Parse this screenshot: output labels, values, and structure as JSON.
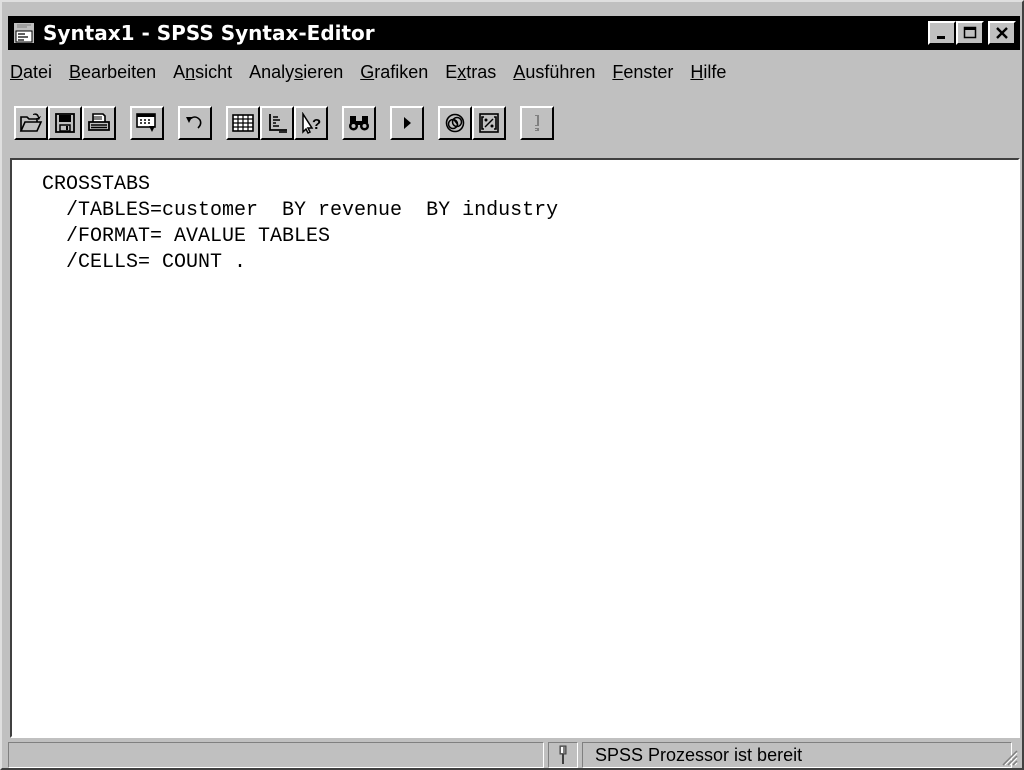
{
  "window": {
    "title": "Syntax1 - SPSS Syntax-Editor",
    "icon": "spss-syntax-icon",
    "controls": [
      "minimize-icon",
      "maximize-icon",
      "close-icon"
    ]
  },
  "menu": {
    "items": [
      {
        "pre": "",
        "acc": "D",
        "post": "atei"
      },
      {
        "pre": "",
        "acc": "B",
        "post": "earbeiten"
      },
      {
        "pre": "A",
        "acc": "n",
        "post": "sicht"
      },
      {
        "pre": "Analy",
        "acc": "s",
        "post": "ieren"
      },
      {
        "pre": "",
        "acc": "G",
        "post": "rafiken"
      },
      {
        "pre": "E",
        "acc": "x",
        "post": "tras"
      },
      {
        "pre": "",
        "acc": "A",
        "post": "usführen"
      },
      {
        "pre": "",
        "acc": "F",
        "post": "enster"
      },
      {
        "pre": "",
        "acc": "H",
        "post": "ilfe"
      }
    ]
  },
  "toolbar": {
    "buttons": [
      "open-icon",
      "save-icon",
      "print-icon",
      "dialog-recall-icon",
      "undo-icon",
      "goto-data-icon",
      "variables-icon",
      "help-icon",
      "find-icon",
      "run-icon",
      "use-sets-icon",
      "designate-window-icon",
      "alert-icon"
    ]
  },
  "editor": {
    "lines": [
      "CROSSTABS",
      "  /TABLES=customer  BY revenue  BY industry",
      "  /FORMAT= AVALUE TABLES",
      "  /CELLS= COUNT ."
    ]
  },
  "status": {
    "message": "SPSS Prozessor  ist bereit",
    "icon": "processor-icon"
  }
}
